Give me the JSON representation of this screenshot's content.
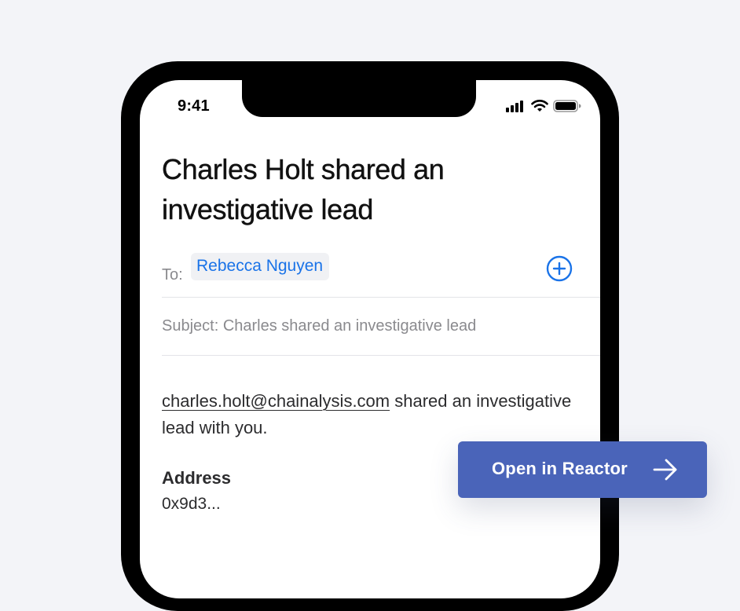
{
  "status_bar": {
    "time": "9:41",
    "icons": [
      "cellular-signal-icon",
      "wifi-icon",
      "battery-icon"
    ]
  },
  "email": {
    "title": "Charles Holt shared an investigative lead",
    "to_label": "To:",
    "recipient": "Rebecca Nguyen",
    "add_recipient_icon": "plus-circle-icon",
    "subject": "Subject: Charles shared an investigative lead",
    "body": {
      "sender_email": "charles.holt@chainalysis.com",
      "message": " shared an investigative lead with you."
    },
    "address_label": "Address",
    "address_value": "0x9d3..."
  },
  "cta": {
    "label": "Open in Reactor",
    "icon": "arrow-right-icon"
  },
  "colors": {
    "page_background": "#f3f4f8",
    "accent_blue": "#1a73e8",
    "cta_background": "#4a64b9"
  }
}
